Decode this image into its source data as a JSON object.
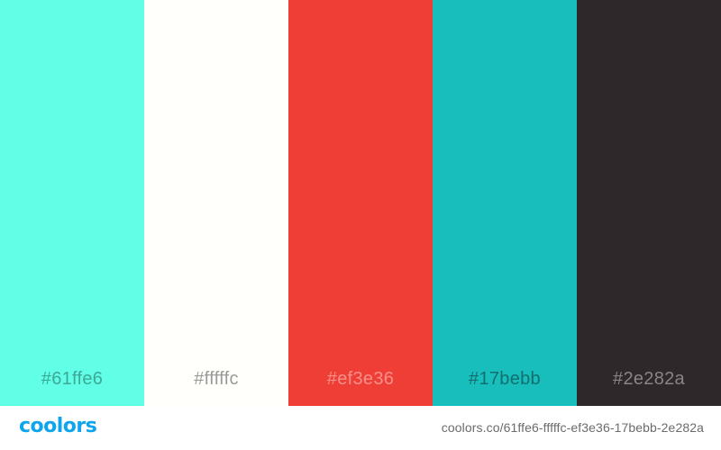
{
  "palette": {
    "swatches": [
      {
        "hex_label": "#61ffe6",
        "color": "#61ffe6",
        "label_color": "#3ca897"
      },
      {
        "hex_label": "#fffffc",
        "color": "#fffffc",
        "label_color": "#9a9a98"
      },
      {
        "hex_label": "#ef3e36",
        "color": "#ef3e36",
        "label_color": "#f7908a"
      },
      {
        "hex_label": "#17bebb",
        "color": "#17bebb",
        "label_color": "#11706e"
      },
      {
        "hex_label": "#2e282a",
        "color": "#2e282a",
        "label_color": "#8a8486"
      }
    ]
  },
  "footer": {
    "logo_text": "coolors",
    "logo_color": "#0ea5ec",
    "url_text": "coolors.co/61ffe6-fffffc-ef3e36-17bebb-2e282a"
  }
}
